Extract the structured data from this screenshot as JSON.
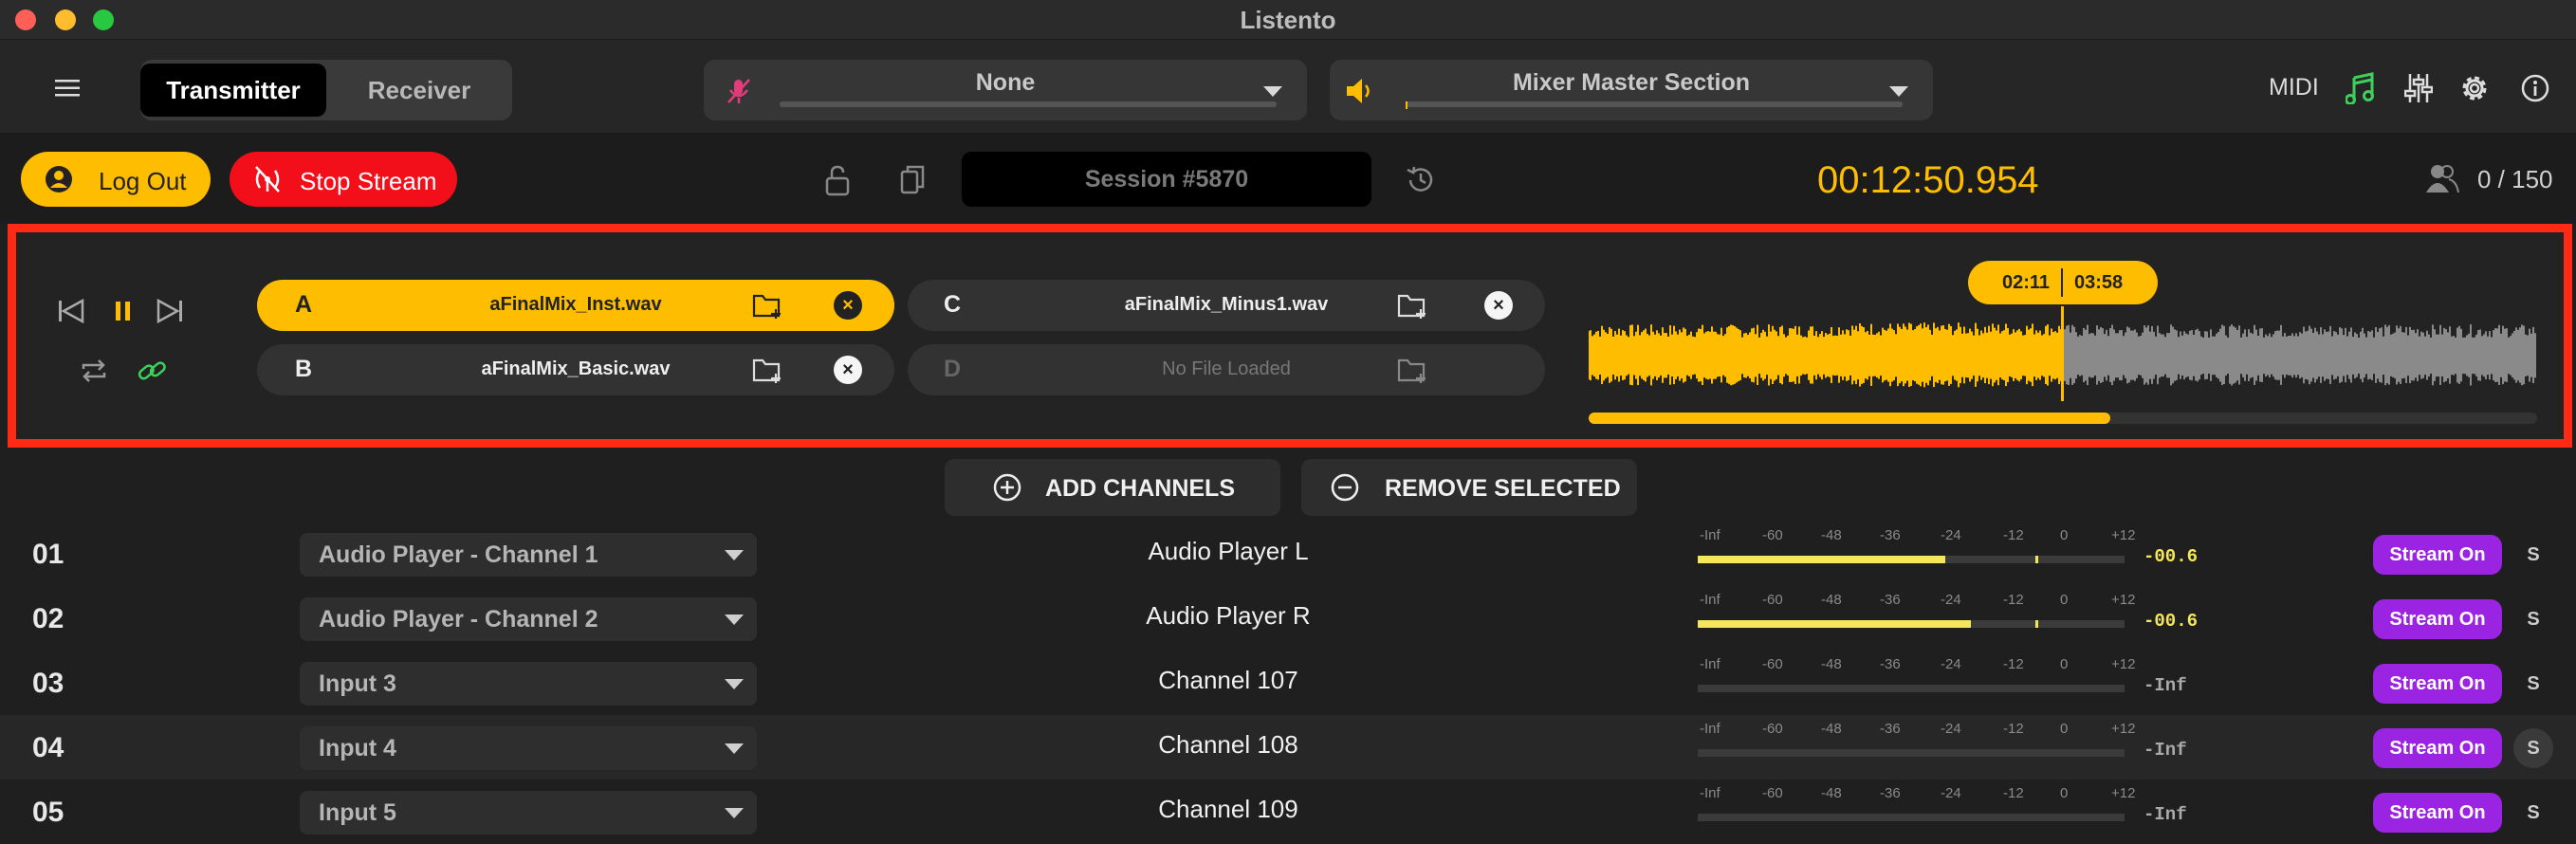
{
  "app_title": "Listento",
  "header": {
    "tabs": [
      {
        "label": "Transmitter",
        "active": true
      },
      {
        "label": "Receiver",
        "active": false
      }
    ],
    "input_device": "None",
    "output_device": "Mixer Master Section",
    "midi_label": "MIDI"
  },
  "toolbar": {
    "logout_label": "Log Out",
    "stop_stream_label": "Stop Stream",
    "session_label": "Session #5870",
    "timer": "00:12:50.954",
    "listeners": "0 / 150"
  },
  "player": {
    "slots": [
      {
        "letter": "A",
        "file": "aFinalMix_Inst.wav",
        "active": true
      },
      {
        "letter": "B",
        "file": "aFinalMix_Basic.wav",
        "active": false
      },
      {
        "letter": "C",
        "file": "aFinalMix_Minus1.wav",
        "active": false
      },
      {
        "letter": "D",
        "file": "No File Loaded",
        "active": false
      }
    ],
    "position": "02:11",
    "duration": "03:58",
    "progress": 0.55
  },
  "actions": {
    "add_label": "ADD CHANNELS",
    "remove_label": "REMOVE SELECTED"
  },
  "meter_scale": [
    "-Inf",
    "-60",
    "-48",
    "-36",
    "-24",
    "-12",
    "0",
    "+12"
  ],
  "channels": [
    {
      "num": "01",
      "source": "Audio Player - Channel 1",
      "name": "Audio Player L",
      "level": "-00.6",
      "meter": 0.58,
      "stream": "Stream On",
      "solo": "S"
    },
    {
      "num": "02",
      "source": "Audio Player - Channel 2",
      "name": "Audio Player R",
      "level": "-00.6",
      "meter": 0.64,
      "stream": "Stream On",
      "solo": "S"
    },
    {
      "num": "03",
      "source": "Input 3",
      "name": "Channel 107",
      "level": "-Inf",
      "meter": 0,
      "stream": "Stream On",
      "solo": "S"
    },
    {
      "num": "04",
      "source": "Input 4",
      "name": "Channel 108",
      "level": "-Inf",
      "meter": 0,
      "stream": "Stream On",
      "solo": "S"
    },
    {
      "num": "05",
      "source": "Input 5",
      "name": "Channel 109",
      "level": "-Inf",
      "meter": 0,
      "stream": "Stream On",
      "solo": "S"
    }
  ],
  "colors": {
    "accent": "#ffbd00",
    "danger": "#f20f1a",
    "stream": "#9b24e3",
    "panel_border": "#ff2a14"
  }
}
